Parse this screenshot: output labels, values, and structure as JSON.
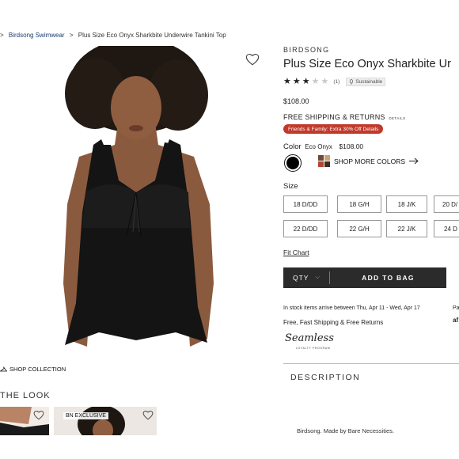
{
  "breadcrumb": {
    "sep": ">",
    "brand": "Birdsong Swimwear",
    "product": "Plus Size Eco Onyx Sharkbite Underwire Tankini Top"
  },
  "product": {
    "brand": "BIRDSONG",
    "title": "Plus Size Eco Onyx Sharkbite Ur",
    "rating": 3,
    "rating_max": 5,
    "review_count": "(1)",
    "sustainable_label": "Sustainable",
    "price": "$108.00",
    "shipping": "FREE SHIPPING & RETURNS",
    "shipping_details": "DETAILS",
    "promo": "Friends & Family: Extra 30% Off   Details"
  },
  "color": {
    "label": "Color",
    "value": "Eco Onyx",
    "price": "$108.00",
    "swatch_hex": "#000000",
    "more_colors": "SHOP MORE COLORS"
  },
  "size": {
    "label": "Size",
    "options": [
      "18 D/DD",
      "18 G/H",
      "18 J/K",
      "20 D/",
      "22 D/DD",
      "22 G/H",
      "22 J/K",
      "24 D"
    ]
  },
  "fit_chart": "Fit Chart",
  "cart": {
    "qty_label": "QTY",
    "add_label": "ADD TO BAG"
  },
  "delivery": {
    "stock_text": "In stock items arrive between Thu, Apr 11 - Wed, Apr 17",
    "free_text": "Free, Fast Shipping & Free Returns",
    "edge1": "Pa",
    "edge2": "af"
  },
  "seamless": {
    "name": "Seamless",
    "sub": "LOYALTY PROGRAM"
  },
  "description": {
    "heading": "DESCRIPTION",
    "tagline": "Birdsong. Made by Bare Necessities."
  },
  "look": {
    "shop_collection": "SHOP COLLECTION",
    "heading": "THE LOOK",
    "badge": "BN EXCLUSIVE"
  },
  "colors": {
    "promo_bg": "#c0392b",
    "bag_bg": "#2b2b2b"
  }
}
